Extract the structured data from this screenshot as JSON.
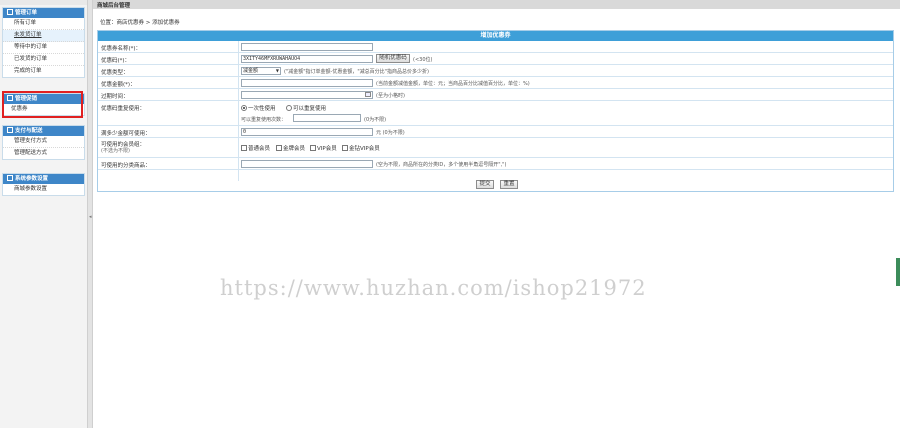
{
  "sidebar": {
    "groups": [
      {
        "title": "管理订单",
        "items": [
          "所有订单",
          "未发货订单",
          "等待中的订单",
          "已发货的订单",
          "完成的订单"
        ],
        "active_index": 1
      },
      {
        "title": "管理促销",
        "items": [
          "优惠券"
        ]
      },
      {
        "title": "支付与配送",
        "items": [
          "管理支付方式",
          "管理配送方式"
        ]
      },
      {
        "title": "系统参数设置",
        "items": [
          "商城参数设置"
        ]
      }
    ]
  },
  "main": {
    "title": "商城后台管理",
    "breadcrumb": "位置：商店优惠券 > 添加优惠券"
  },
  "form": {
    "header": "增加优惠券",
    "name_label": "优惠券名称(*)：",
    "code_label": "优惠码(*)：",
    "code_value": "3XITY46MFXRUWAHAUO4",
    "code_btn": "随机优惠码",
    "code_hint": "(<30位)",
    "type_label": "优惠类型：",
    "type_value": "减金额",
    "type_hint": "(\"减金额\"指订单金额-优惠金额，\"减总百分比\"指商品总价多少折)",
    "amount_label": "优惠金额(*)：",
    "amount_hint": "(当前金额减值金额，单位：元；当商品百分比减值百分比，单位：%)",
    "expire_label": "过期时间：",
    "expire_hint": "(至为小格时)",
    "reuse_label": "优惠码重复使用：",
    "reuse_opt1": "一次性使用",
    "reuse_opt2": "可以重复使用",
    "reuse_count_label": "可以重复使用次数：",
    "reuse_count_hint": "(0为不限)",
    "min_label": "满多少金额可使用：",
    "min_value": "0",
    "min_hint": "元 (0为不限)",
    "member_label": "可使用的会员组：",
    "member_sub": "(不选为不限)",
    "member_opts": [
      "普通会员",
      "金牌会员",
      "VIP会员",
      "金钻VIP会员"
    ],
    "cat_label": "可使用的分类商品：",
    "cat_hint": "(空为不限，商品所在的分类ID，多个使用半角逗号隔开\",\")",
    "submit": "提交",
    "reset": "重置"
  },
  "watermark": "https://www.huzhan.com/ishop21972",
  "colors": {
    "accent": "#3e86c8",
    "panel_header": "#3e9fd8",
    "highlight": "#e02020"
  }
}
